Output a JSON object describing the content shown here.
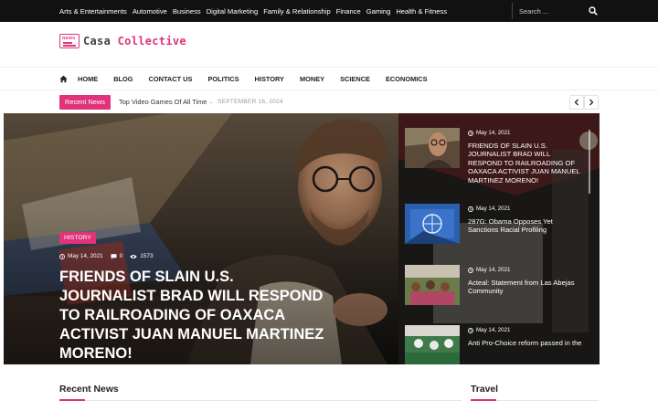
{
  "topnav": {
    "items": [
      "Arts & Entertainments",
      "Automotive",
      "Business",
      "Digital Marketing",
      "Family & Relationship",
      "Finance",
      "Gaming",
      "Health & Fitness"
    ],
    "search_placeholder": "Search ..."
  },
  "logo": {
    "badge": "NEWS",
    "text_a": "Casa",
    "text_b": "Collective"
  },
  "mainnav": {
    "items": [
      "HOME",
      "BLOG",
      "CONTACT US",
      "POLITICS",
      "HISTORY",
      "MONEY",
      "SCIENCE",
      "ECONOMICS"
    ]
  },
  "ticker": {
    "label": "Recent News",
    "headline": "Top Video Games Of All Time",
    "separator": "–",
    "date": "SEPTEMBER 16, 2024"
  },
  "hero": {
    "category": "HISTORY",
    "date": "May 14, 2021",
    "comments": "0",
    "views": "1573",
    "title": "FRIENDS OF SLAIN U.S. JOURNALIST BRAD WILL RESPOND TO RAILROADING OF OAXACA ACTIVIST JUAN MANUEL MARTINEZ MORENO!"
  },
  "side_posts": [
    {
      "date": "May 14, 2021",
      "title": "FRIENDS OF SLAIN U.S. JOURNALIST BRAD WILL RESPOND TO RAILROADING OF OAXACA ACTIVIST JUAN MANUEL MARTINEZ MORENO!"
    },
    {
      "date": "May 14, 2021",
      "title": "287G: Obama Opposes Yet Sanctions Racial Profiling"
    },
    {
      "date": "May 14, 2021",
      "title": "Acteal: Statement from Las Abejas Community"
    },
    {
      "date": "May 14, 2021",
      "title": "Anti Pro-Choice reform passed in the"
    }
  ],
  "sections": {
    "recent": "Recent News",
    "travel": "Travel"
  },
  "colors": {
    "accent": "#e0337a",
    "topbar": "#111111"
  }
}
